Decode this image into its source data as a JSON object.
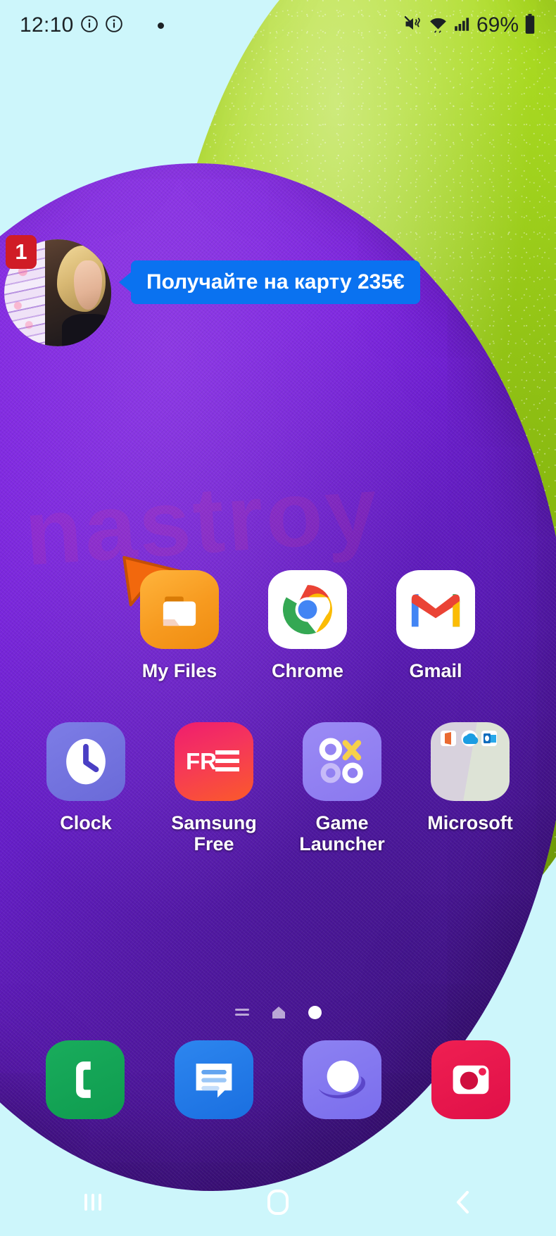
{
  "status_bar": {
    "time": "12:10",
    "battery_percent": "69%",
    "icons": [
      "info-circle-icon",
      "info-circle-icon",
      "notification-dot-icon",
      "mute-vibrate-icon",
      "wifi-icon",
      "signal-bars-icon",
      "battery-icon"
    ]
  },
  "promo_notification": {
    "badge_count": "1",
    "message": "Получайте на карту 235€",
    "avatar_name": "contact-avatar",
    "cursor": "orange-arrow-cursor",
    "bubble_color": "#0a72f0",
    "badge_color": "#d01c26"
  },
  "app_grid": {
    "row1": [
      {
        "label": "My Files",
        "icon": "my-files-icon"
      },
      {
        "label": "Chrome",
        "icon": "chrome-icon"
      },
      {
        "label": "Gmail",
        "icon": "gmail-icon"
      }
    ],
    "row2": [
      {
        "label": "Clock",
        "icon": "clock-icon"
      },
      {
        "label": "Samsung Free",
        "icon": "samsung-free-icon",
        "logo_text": "FREE"
      },
      {
        "label": "Game Launcher",
        "icon": "game-launcher-icon"
      },
      {
        "label": "Microsoft",
        "icon": "microsoft-folder-icon"
      }
    ]
  },
  "page_indicator": {
    "items": [
      "lines-icon",
      "home-icon",
      "current-page-dot"
    ],
    "current": 3,
    "total": 3
  },
  "dock": [
    {
      "label": "Phone",
      "icon": "phone-icon"
    },
    {
      "label": "Messages",
      "icon": "messages-icon"
    },
    {
      "label": "Samsung Internet",
      "icon": "internet-icon"
    },
    {
      "label": "Camera",
      "icon": "camera-icon"
    }
  ],
  "nav_bar": [
    {
      "label": "Recents",
      "icon": "recents-icon"
    },
    {
      "label": "Home",
      "icon": "home-square-icon"
    },
    {
      "label": "Back",
      "icon": "back-chevron-icon"
    }
  ],
  "wallpaper": {
    "background_color": "#cdf6fb",
    "green_shape_color": "#a6d820",
    "purple_shape_color": "#7b22e0",
    "watermark_text": "nastroy"
  }
}
